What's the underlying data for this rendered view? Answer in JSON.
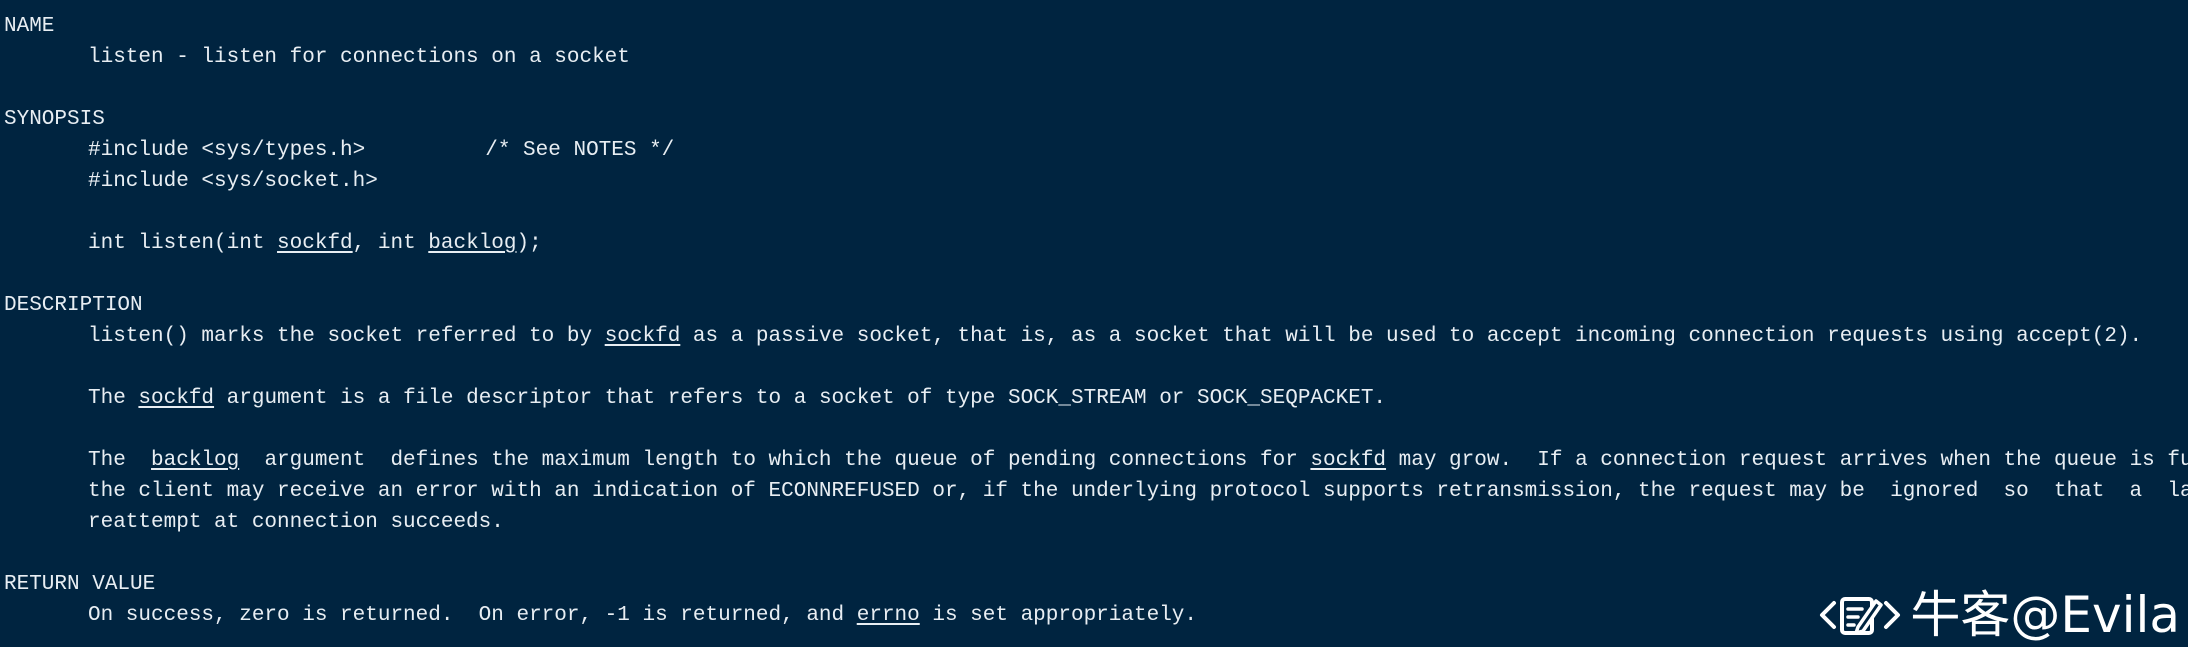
{
  "sections": {
    "name": {
      "heading": "NAME",
      "line": "listen - listen for connections on a socket"
    },
    "synopsis": {
      "heading": "SYNOPSIS",
      "include1": "#include <sys/types.h>",
      "include1_comment": "/* See NOTES */",
      "include2": "#include <sys/socket.h>",
      "proto_prefix": "int listen(int ",
      "proto_arg1": "sockfd",
      "proto_mid": ", int ",
      "proto_arg2": "backlog",
      "proto_suffix": ");"
    },
    "description": {
      "heading": "DESCRIPTION",
      "p1_a": "listen() marks the socket referred to by ",
      "p1_u": "sockfd",
      "p1_b": " as a passive socket, that is, as a socket that will be used to accept incoming connection requests using accept(2).",
      "p2_a": "The ",
      "p2_u": "sockfd",
      "p2_b": " argument is a file descriptor that refers to a socket of type SOCK_STREAM or SOCK_SEQPACKET.",
      "p3_l1_a": "The  ",
      "p3_l1_u": "backlog",
      "p3_l1_b": "  argument  defines the maximum length to which the queue of pending connections for ",
      "p3_l1_u2": "sockfd",
      "p3_l1_c": " may grow.  If a connection request arrives when the queue is full,",
      "p3_l2": "the client may receive an error with an indication of ECONNREFUSED or, if the underlying protocol supports retransmission, the request may be  ignored  so  that  a  later",
      "p3_l3": "reattempt at connection succeeds."
    },
    "return_value": {
      "heading": "RETURN VALUE",
      "line_a": "On success, zero is returned.  On error, -1 is returned, and ",
      "line_u": "errno",
      "line_b": " is set appropriately."
    }
  },
  "watermark": {
    "icon": "code-note-icon",
    "text": "牛客@Evila"
  },
  "colors": {
    "background": "#002440",
    "text": "#e8eef3"
  }
}
